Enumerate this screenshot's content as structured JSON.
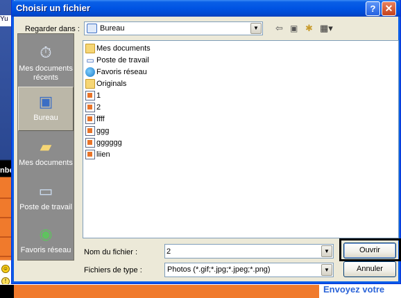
{
  "background": {
    "left_partial": "Yu",
    "left_partial_2": "nbe",
    "promo_text": "Envoyez votre"
  },
  "dialog": {
    "title": "Choisir un fichier",
    "help_glyph": "?",
    "close_glyph": "✕",
    "look_in_label": "Regarder dans :",
    "look_in_value": "Bureau",
    "places": [
      {
        "label": "Mes documents récents",
        "icon": "recent-documents-icon"
      },
      {
        "label": "Bureau",
        "icon": "desktop-icon"
      },
      {
        "label": "Mes documents",
        "icon": "my-documents-icon"
      },
      {
        "label": "Poste de travail",
        "icon": "my-computer-icon"
      },
      {
        "label": "Favoris réseau",
        "icon": "network-places-icon"
      }
    ],
    "files": [
      {
        "name": "Mes documents",
        "icon": "folder-icon"
      },
      {
        "name": "Poste de travail",
        "icon": "computer-icon"
      },
      {
        "name": "Favoris réseau",
        "icon": "network-icon"
      },
      {
        "name": "Originals",
        "icon": "folder-icon"
      },
      {
        "name": "1",
        "icon": "document-icon"
      },
      {
        "name": "2",
        "icon": "document-icon"
      },
      {
        "name": "ffff",
        "icon": "document-icon"
      },
      {
        "name": "ggg",
        "icon": "document-icon"
      },
      {
        "name": "gggggg",
        "icon": "document-icon"
      },
      {
        "name": "liien",
        "icon": "document-icon"
      }
    ],
    "filename_label": "Nom du fichier :",
    "filename_value": "2",
    "filetype_label": "Fichiers de type :",
    "filetype_value": "Photos (*.gif;*.jpg;*.jpeg;*.png)",
    "open_button": "Ouvrir",
    "cancel_button": "Annuler"
  }
}
